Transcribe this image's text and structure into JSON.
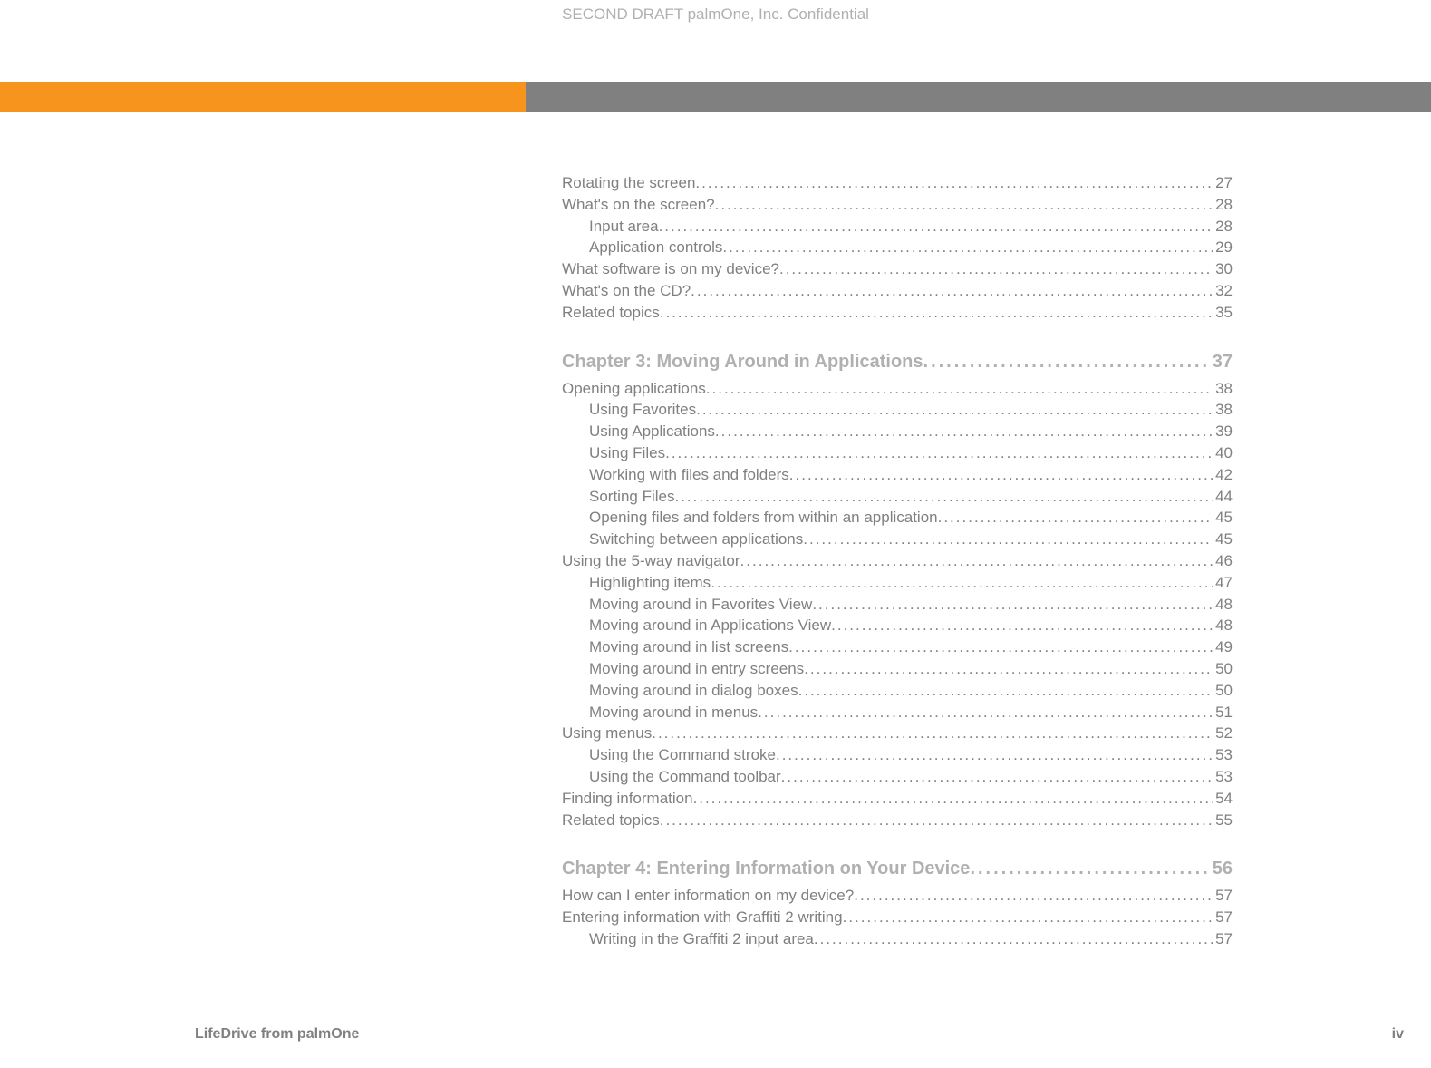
{
  "header": "SECOND DRAFT palmOne, Inc.  Confidential",
  "toc_pre": [
    {
      "title": "Rotating the screen",
      "page": "27",
      "indent": false
    },
    {
      "title": "What's on the screen?",
      "page": "28",
      "indent": false
    },
    {
      "title": "Input area",
      "page": "28",
      "indent": true
    },
    {
      "title": "Application controls",
      "page": "29",
      "indent": true
    },
    {
      "title": "What software is on my device?",
      "page": "30",
      "indent": false
    },
    {
      "title": "What's on the CD?",
      "page": "32",
      "indent": false
    },
    {
      "title": "Related topics",
      "page": "35",
      "indent": false
    }
  ],
  "chapter3": {
    "label": "Chapter 3:  Moving Around in Applications",
    "page": "37"
  },
  "toc_ch3": [
    {
      "title": "Opening applications",
      "page": "38",
      "indent": false
    },
    {
      "title": "Using Favorites",
      "page": "38",
      "indent": true
    },
    {
      "title": "Using Applications",
      "page": "39",
      "indent": true
    },
    {
      "title": "Using Files",
      "page": "40",
      "indent": true
    },
    {
      "title": "Working with files and folders",
      "page": "42",
      "indent": true
    },
    {
      "title": "Sorting Files",
      "page": "44",
      "indent": true
    },
    {
      "title": "Opening files and folders from within an application",
      "page": "45",
      "indent": true
    },
    {
      "title": "Switching between applications",
      "page": "45",
      "indent": true
    },
    {
      "title": "Using the 5-way navigator",
      "page": "46",
      "indent": false
    },
    {
      "title": "Highlighting items",
      "page": "47",
      "indent": true
    },
    {
      "title": "Moving around in Favorites View",
      "page": "48",
      "indent": true
    },
    {
      "title": "Moving around in Applications View",
      "page": "48",
      "indent": true
    },
    {
      "title": "Moving around in list screens",
      "page": "49",
      "indent": true
    },
    {
      "title": "Moving around in entry screens",
      "page": "50",
      "indent": true
    },
    {
      "title": "Moving around in dialog boxes",
      "page": "50",
      "indent": true
    },
    {
      "title": "Moving around in menus",
      "page": "51",
      "indent": true
    },
    {
      "title": "Using menus",
      "page": "52",
      "indent": false
    },
    {
      "title": "Using the Command stroke",
      "page": "53",
      "indent": true
    },
    {
      "title": "Using the Command toolbar",
      "page": "53",
      "indent": true
    },
    {
      "title": "Finding information",
      "page": "54",
      "indent": false
    },
    {
      "title": "Related topics",
      "page": "55",
      "indent": false
    }
  ],
  "chapter4": {
    "label": "Chapter 4:  Entering Information on Your Device",
    "page": "56"
  },
  "toc_ch4": [
    {
      "title": "How can I enter information on my device?",
      "page": "57",
      "indent": false
    },
    {
      "title": "Entering information with Graffiti 2 writing",
      "page": "57",
      "indent": false
    },
    {
      "title": "Writing in the Graffiti 2 input area",
      "page": "57",
      "indent": true
    }
  ],
  "footer_left": "LifeDrive from palmOne",
  "footer_right": "iv"
}
